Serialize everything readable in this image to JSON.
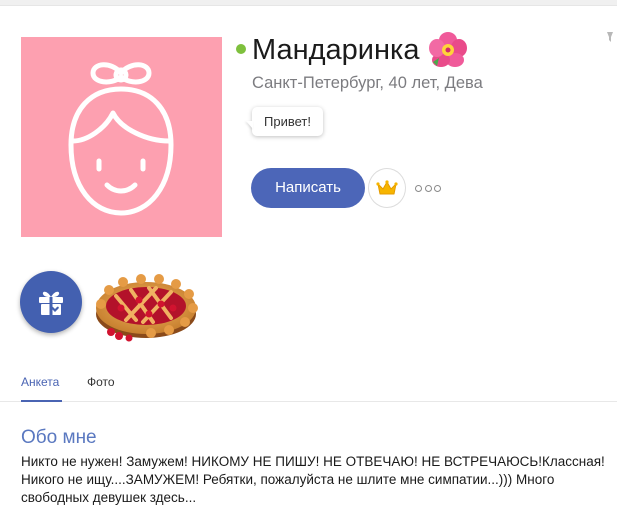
{
  "profile": {
    "name": "Мандаринка",
    "subtitle": "Санкт-Петербург, 40 лет, Дева",
    "status": "Привет!",
    "online": true,
    "name_emoji": "hibiscus-icon"
  },
  "actions": {
    "write_label": "Написать",
    "crown_icon": "crown-icon",
    "more_icon": "more-dots-icon"
  },
  "gifts": {
    "gift_icon": "gift-icon",
    "items": [
      {
        "name": "cherry-pie"
      }
    ]
  },
  "tabs": [
    {
      "label": "Анкета",
      "active": true
    },
    {
      "label": "Фото",
      "active": false
    }
  ],
  "about": {
    "title": "Обо мне",
    "text": "Никто не нужен! Замужем! НИКОМУ НЕ ПИШУ! НЕ ОТВЕЧАЮ! НЕ ВСТРЕЧАЮСЬ!Классная! Никого не ищу....ЗАМУЖЕМ! Ребятки, пожалуйста не шлите мне симпатии...))) Много свободных девушек здесь..."
  },
  "colors": {
    "accent": "#4c66b8",
    "avatar_bg": "#fda0b0",
    "online": "#7ec03d",
    "about_title": "#5a78c0"
  }
}
